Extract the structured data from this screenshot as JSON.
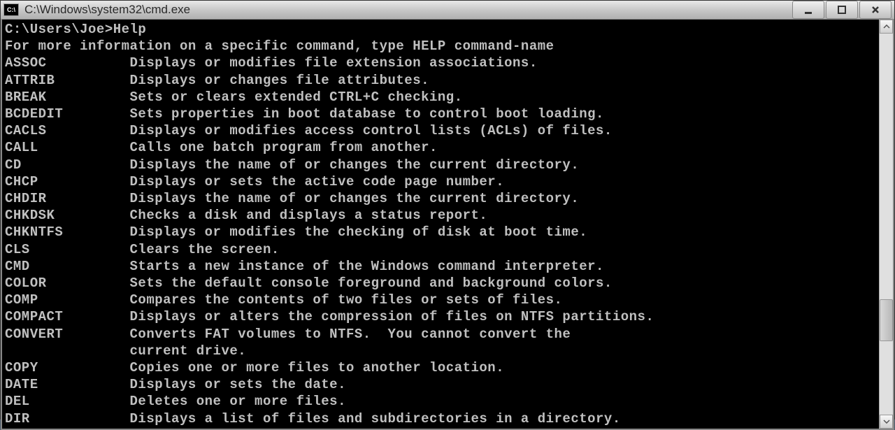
{
  "window": {
    "title": "C:\\Windows\\system32\\cmd.exe",
    "icon_label": "C:\\"
  },
  "terminal": {
    "prompt": "C:\\Users\\Joe>",
    "command": "Help",
    "help_header": "For more information on a specific command, type HELP command-name",
    "commands": [
      {
        "name": "ASSOC",
        "desc": "Displays or modifies file extension associations."
      },
      {
        "name": "ATTRIB",
        "desc": "Displays or changes file attributes."
      },
      {
        "name": "BREAK",
        "desc": "Sets or clears extended CTRL+C checking."
      },
      {
        "name": "BCDEDIT",
        "desc": "Sets properties in boot database to control boot loading."
      },
      {
        "name": "CACLS",
        "desc": "Displays or modifies access control lists (ACLs) of files."
      },
      {
        "name": "CALL",
        "desc": "Calls one batch program from another."
      },
      {
        "name": "CD",
        "desc": "Displays the name of or changes the current directory."
      },
      {
        "name": "CHCP",
        "desc": "Displays or sets the active code page number."
      },
      {
        "name": "CHDIR",
        "desc": "Displays the name of or changes the current directory."
      },
      {
        "name": "CHKDSK",
        "desc": "Checks a disk and displays a status report."
      },
      {
        "name": "CHKNTFS",
        "desc": "Displays or modifies the checking of disk at boot time."
      },
      {
        "name": "CLS",
        "desc": "Clears the screen."
      },
      {
        "name": "CMD",
        "desc": "Starts a new instance of the Windows command interpreter."
      },
      {
        "name": "COLOR",
        "desc": "Sets the default console foreground and background colors."
      },
      {
        "name": "COMP",
        "desc": "Compares the contents of two files or sets of files."
      },
      {
        "name": "COMPACT",
        "desc": "Displays or alters the compression of files on NTFS partitions."
      },
      {
        "name": "CONVERT",
        "desc": "Converts FAT volumes to NTFS.  You cannot convert the"
      },
      {
        "name": "",
        "desc": "current drive."
      },
      {
        "name": "COPY",
        "desc": "Copies one or more files to another location."
      },
      {
        "name": "DATE",
        "desc": "Displays or sets the date."
      },
      {
        "name": "DEL",
        "desc": "Deletes one or more files."
      },
      {
        "name": "DIR",
        "desc": "Displays a list of files and subdirectories in a directory."
      }
    ]
  }
}
